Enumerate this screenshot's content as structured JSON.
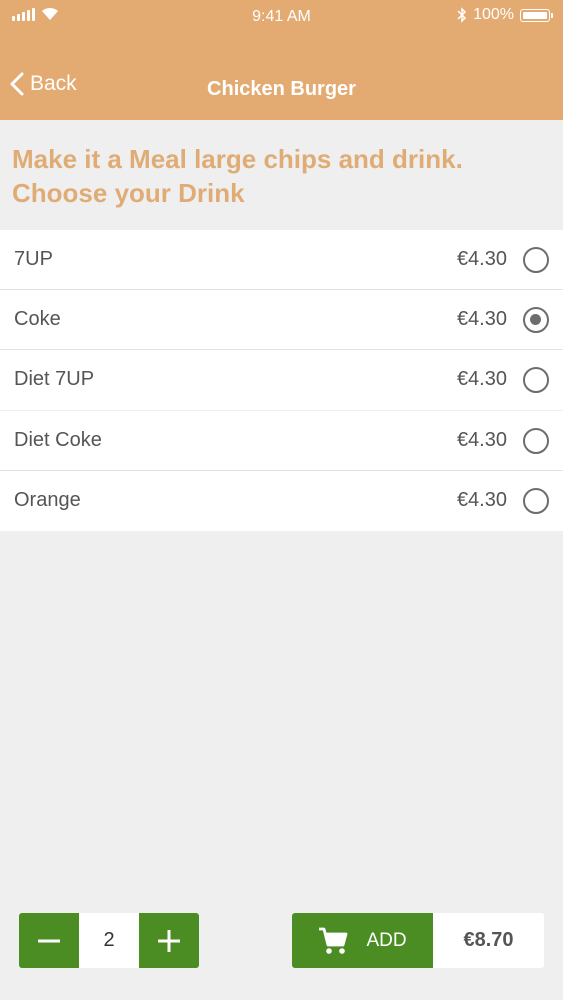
{
  "status_bar": {
    "time": "9:41 AM",
    "battery": "100%"
  },
  "nav": {
    "back_label": "Back",
    "title": "Chicken Burger"
  },
  "section": {
    "heading": "Make it a Meal large chips and drink. Choose your Drink"
  },
  "options": [
    {
      "name": "7UP",
      "price": "€4.30",
      "selected": false
    },
    {
      "name": "Coke",
      "price": "€4.30",
      "selected": true
    },
    {
      "name": "Diet 7UP",
      "price": "€4.30",
      "selected": false
    },
    {
      "name": "Diet Coke",
      "price": "€4.30",
      "selected": false
    },
    {
      "name": "Orange",
      "price": "€4.30",
      "selected": false
    }
  ],
  "footer": {
    "quantity": "2",
    "add_label": "ADD",
    "total": "€8.70"
  },
  "colors": {
    "header": "#e3ab72",
    "accent": "#4b8d22",
    "heading": "#e0ac76"
  }
}
